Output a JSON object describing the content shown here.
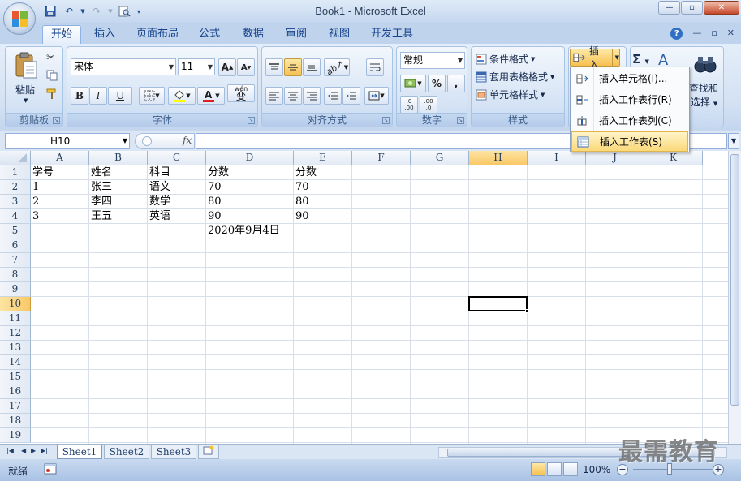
{
  "window": {
    "title": "Book1 - Microsoft Excel"
  },
  "tabs": [
    "开始",
    "插入",
    "页面布局",
    "公式",
    "数据",
    "审阅",
    "视图",
    "开发工具"
  ],
  "active_tab": "开始",
  "ribbon": {
    "clipboard": {
      "label": "剪贴板",
      "paste_label": "粘贴"
    },
    "font": {
      "label": "字体",
      "font_name": "宋体",
      "font_size": "11",
      "grow": "A",
      "shrink": "A",
      "bold": "B",
      "italic": "I",
      "underline": "U",
      "phonetic": "wén",
      "phonetic_char": "变"
    },
    "alignment": {
      "label": "对齐方式"
    },
    "number": {
      "label": "数字",
      "format": "常规",
      "percent": "%",
      "comma": ",",
      "inc": ".0 .00",
      "dec": ".00 .0"
    },
    "styles": {
      "label": "样式",
      "conditional": "条件格式",
      "table": "套用表格格式",
      "cell": "单元格样式"
    },
    "cells": {
      "insert": "插入"
    },
    "editing": {
      "sigma": "Σ",
      "find_line1": "查找和",
      "find_line2": "选择"
    }
  },
  "insert_menu": [
    {
      "label": "插入单元格(I)...",
      "icon": "insert-cells-icon"
    },
    {
      "label": "插入工作表行(R)",
      "icon": "insert-row-icon"
    },
    {
      "label": "插入工作表列(C)",
      "icon": "insert-column-icon"
    },
    {
      "label": "插入工作表(S)",
      "icon": "insert-sheet-icon"
    }
  ],
  "highlighted_menu_index": 3,
  "formula_bar": {
    "name_box": "H10",
    "fx": "fx",
    "content": ""
  },
  "columns": [
    "A",
    "B",
    "C",
    "D",
    "E",
    "F",
    "G",
    "H",
    "I",
    "J",
    "K"
  ],
  "selected_column": "H",
  "rows": [
    "1",
    "2",
    "3",
    "4",
    "5",
    "6",
    "7",
    "8",
    "9",
    "10",
    "11",
    "12",
    "13",
    "14",
    "15",
    "16",
    "17",
    "18",
    "19"
  ],
  "selected_row": "10",
  "cells": [
    {
      "ref": "A1",
      "value": "学号"
    },
    {
      "ref": "B1",
      "value": "姓名"
    },
    {
      "ref": "C1",
      "value": "科目"
    },
    {
      "ref": "D1",
      "value": "分数"
    },
    {
      "ref": "E1",
      "value": "分数"
    },
    {
      "ref": "A2",
      "value": "1"
    },
    {
      "ref": "B2",
      "value": "张三"
    },
    {
      "ref": "C2",
      "value": "语文"
    },
    {
      "ref": "D2",
      "value": "70"
    },
    {
      "ref": "E2",
      "value": "70"
    },
    {
      "ref": "A3",
      "value": "2"
    },
    {
      "ref": "B3",
      "value": "李四"
    },
    {
      "ref": "C3",
      "value": "数学"
    },
    {
      "ref": "D3",
      "value": "80"
    },
    {
      "ref": "E3",
      "value": "80"
    },
    {
      "ref": "A4",
      "value": "3"
    },
    {
      "ref": "B4",
      "value": "王五"
    },
    {
      "ref": "C4",
      "value": "英语"
    },
    {
      "ref": "D4",
      "value": "90"
    },
    {
      "ref": "E4",
      "value": "90"
    },
    {
      "ref": "D5",
      "value": "2020年9月4日"
    }
  ],
  "sheets": [
    "Sheet1",
    "Sheet2",
    "Sheet3"
  ],
  "active_sheet": "Sheet1",
  "status": {
    "ready": "就绪",
    "zoom": "100%",
    "zoom_out": "−",
    "zoom_in": "+"
  },
  "watermark": "最需教育"
}
